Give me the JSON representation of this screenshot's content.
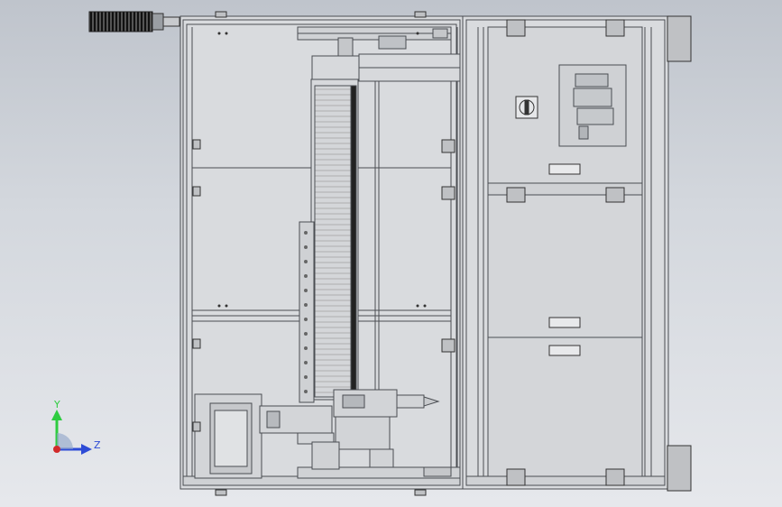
{
  "viewport": {
    "background_top": "#bfc4cc",
    "background_bottom": "#e6e8ec",
    "line_color": "#4a4d52",
    "panel_fill": "#d9dbde"
  },
  "triad": {
    "y_label": "Y",
    "z_label": "Z",
    "y_color": "#2ecc40",
    "z_color": "#2d4bd6",
    "x_color": "#d12a2a"
  }
}
